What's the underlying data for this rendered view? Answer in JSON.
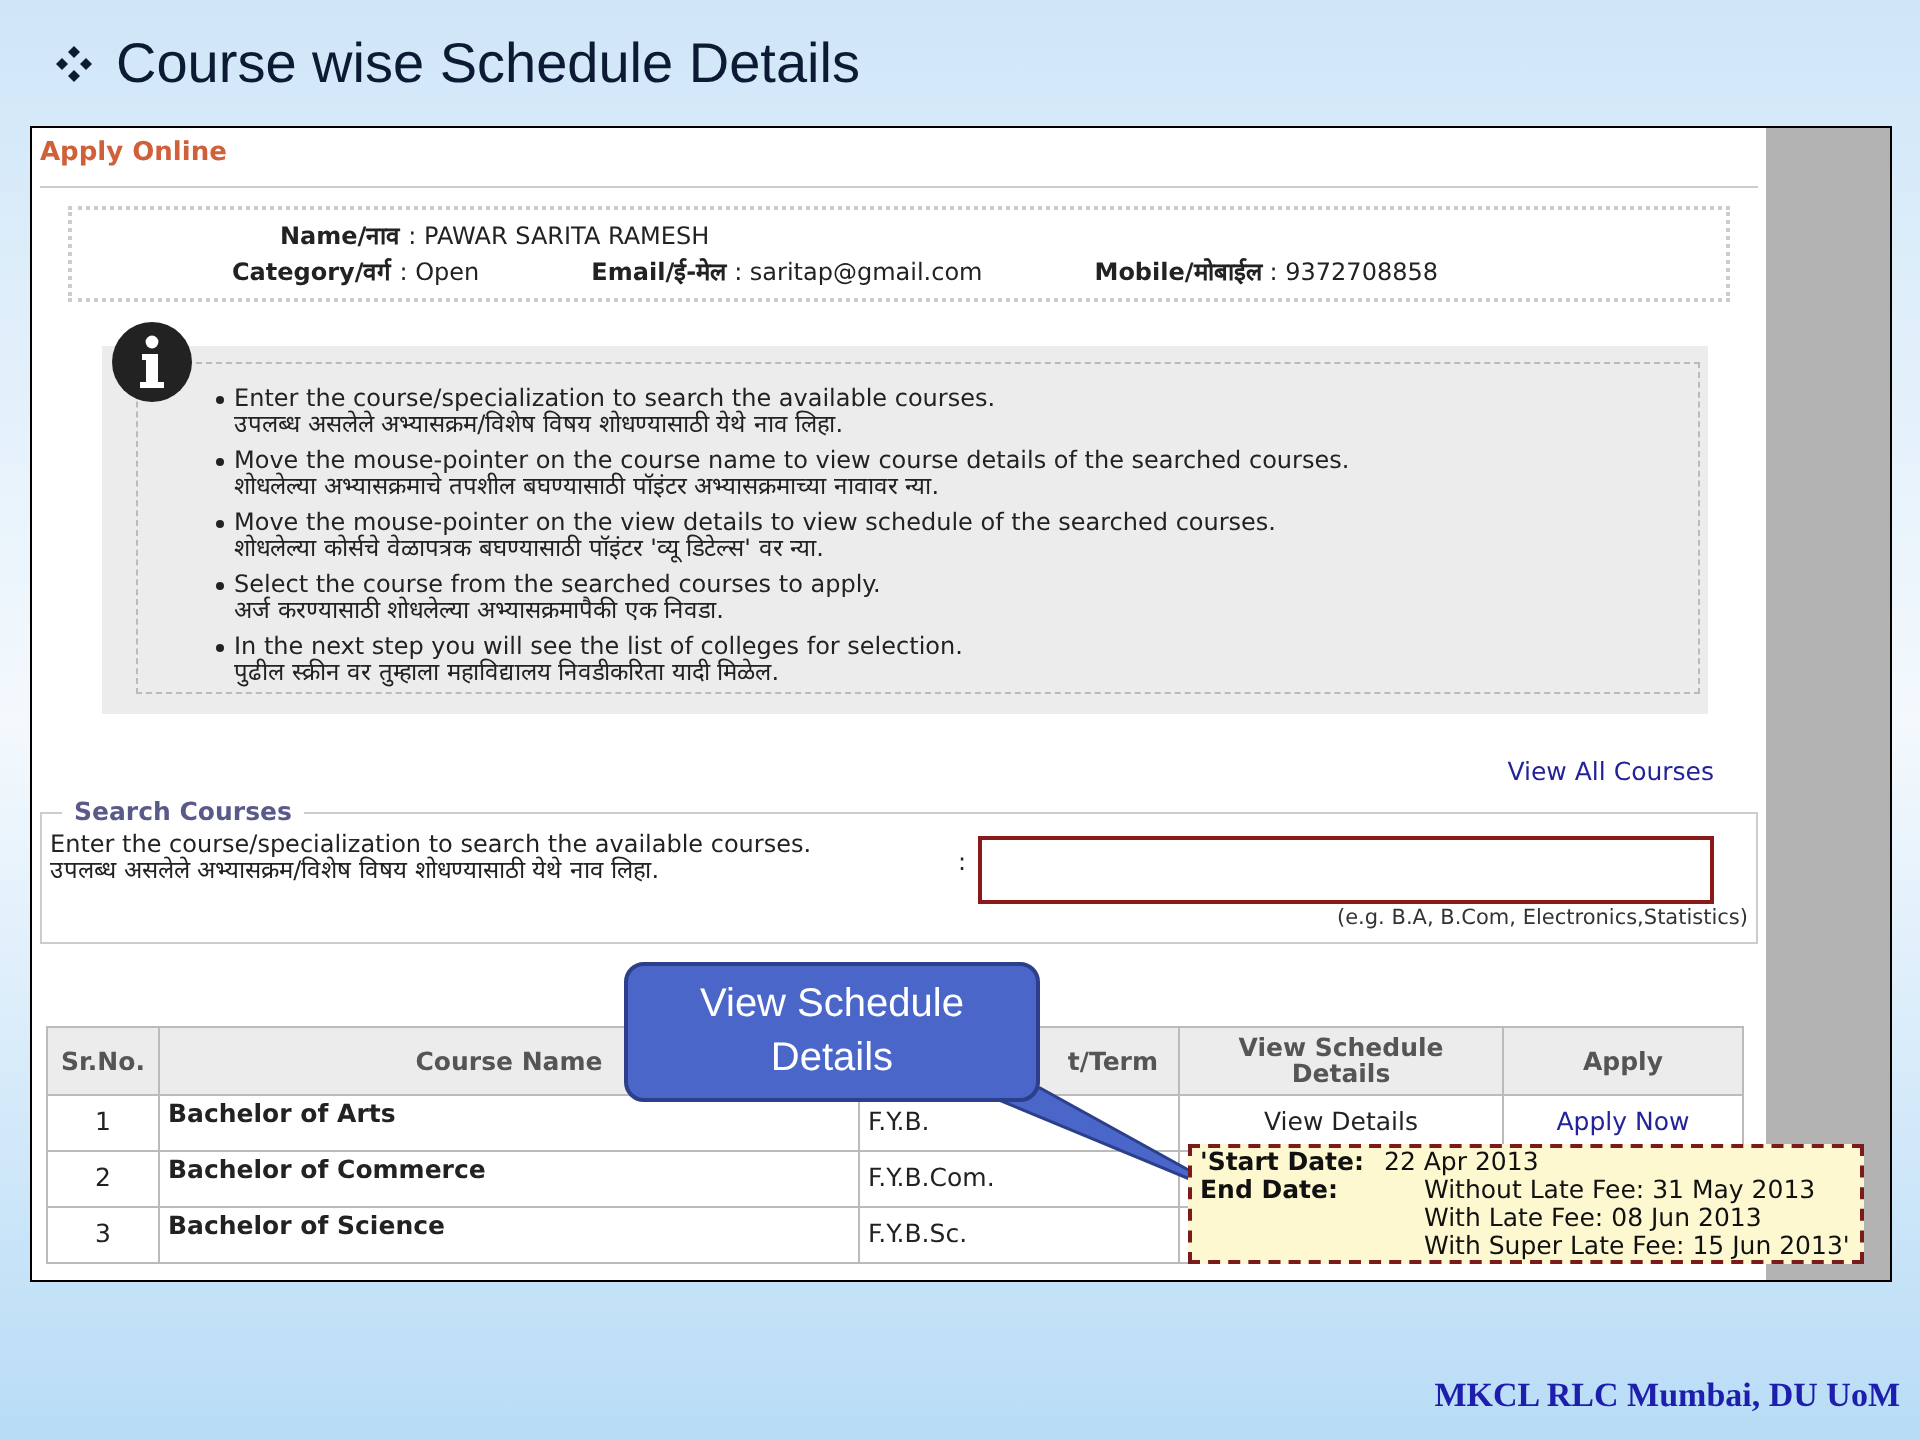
{
  "slide": {
    "title": "Course wise Schedule Details",
    "footer": "MKCL RLC Mumbai, DU UoM"
  },
  "panel": {
    "title": "Apply Online"
  },
  "applicant": [
    [
      {
        "label": "Name/नाव",
        "value": ": PAWAR SARITA RAMESH"
      }
    ],
    [
      {
        "label": "Category/वर्ग",
        "value": ": Open"
      },
      {
        "label": "Email/ई-मेल",
        "value": ": saritap@gmail.com"
      },
      {
        "label": "Mobile/मोबाईल",
        "value": ": 9372708858"
      }
    ]
  ],
  "instructions": [
    {
      "en": "Enter the course/specialization to search the available courses.",
      "mr": "उपलब्ध असलेले अभ्यासक्रम/विशेष विषय शोधण्यासाठी येथे नाव लिहा."
    },
    {
      "en": "Move the mouse-pointer on the course name to view course details of the searched courses.",
      "mr": "शोधलेल्या अभ्यासक्रमाचे तपशील बघण्यासाठी पॉइंटर अभ्यासक्रमाच्या नावावर न्या."
    },
    {
      "en": "Move the mouse-pointer on the view details to view schedule of the searched courses.",
      "mr": "शोधलेल्या कोर्सचे वेळापत्रक बघण्यासाठी पॉइंटर 'व्यू डिटेल्स' वर न्या."
    },
    {
      "en": "Select the course from the searched courses to apply.",
      "mr": "अर्ज करण्यासाठी शोधलेल्या अभ्यासक्रमापैकी एक निवडा."
    },
    {
      "en": "In the next step you will see the list of colleges for selection.",
      "mr": "पुढील स्क्रीन वर तुम्हाला महाविद्यालय निवडीकरिता यादी मिळेल."
    }
  ],
  "view_all_link": "View All Courses",
  "search": {
    "legend": "Search Courses",
    "label_en": "Enter the course/specialization to search the available courses.",
    "label_mr": "उपलब्ध असलेले अभ्यासक्रम/विशेष विषय शोधण्यासाठी येथे नाव लिहा.",
    "colon": ":",
    "hint": "(e.g. B.A, B.Com, Electronics,Statistics)"
  },
  "table": {
    "columns": [
      "Sr.No.",
      "Course Name",
      "t/Term",
      "View Schedule Details",
      "Apply"
    ],
    "rows": [
      {
        "cells": [
          "1",
          "Bachelor of Arts",
          "F.Y.B.",
          "View Details",
          "Apply Now"
        ]
      },
      {
        "cells": [
          "2",
          "Bachelor of Commerce",
          "F.Y.B.Com."
        ]
      },
      {
        "cells": [
          "3",
          "Bachelor of Science",
          "F.Y.B.Sc."
        ]
      }
    ]
  },
  "callout": "View Schedule Details",
  "tooltip": {
    "start_label": "'Start Date:",
    "start": "22 Apr 2013",
    "end_label": "End Date:",
    "end_lines": [
      "Without Late Fee: 31 May 2013",
      "With Late Fee: 08 Jun 2013",
      "With Super Late Fee: 15 Jun 2013'"
    ]
  }
}
